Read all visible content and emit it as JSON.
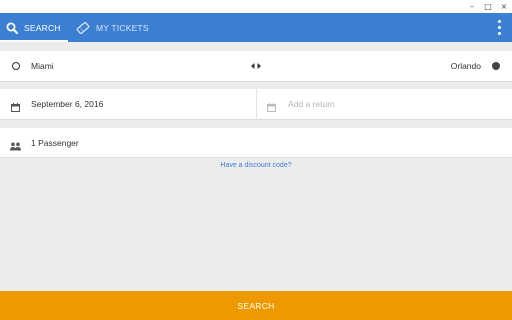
{
  "window": {
    "minimize_glyph": "–",
    "maximize_glyph": "□",
    "close_glyph": "×"
  },
  "appbar": {
    "color": "#3b7fd3",
    "tabs": [
      {
        "label": "SEARCH",
        "icon": "search-icon",
        "selected": true
      },
      {
        "label": "MY TICKETS",
        "icon": "ticket-icon",
        "selected": false
      }
    ],
    "overflow_icon": "more-vert-icon"
  },
  "route": {
    "origin": "Miami",
    "destination": "Orlando",
    "swap_icon": "swap-horizontal-icon"
  },
  "dates": {
    "departure": "September 6, 2016",
    "return_placeholder": "Add a return"
  },
  "passengers": {
    "label": "1 Passenger"
  },
  "discount_link": "Have a discount code?",
  "search_button": {
    "label": "SEARCH",
    "color": "#ee9900"
  }
}
